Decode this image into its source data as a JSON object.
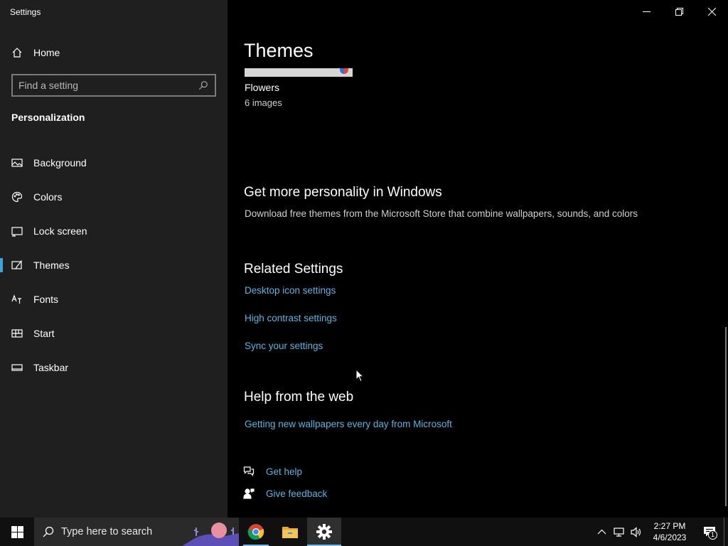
{
  "window": {
    "title": "Settings",
    "controls": [
      "minimize",
      "restore",
      "close"
    ]
  },
  "sidebar": {
    "home_label": "Home",
    "search_placeholder": "Find a setting",
    "section_title": "Personalization",
    "items": [
      {
        "label": "Background",
        "icon": "picture-icon"
      },
      {
        "label": "Colors",
        "icon": "palette-icon"
      },
      {
        "label": "Lock screen",
        "icon": "lock-screen-icon"
      },
      {
        "label": "Themes",
        "icon": "brush-icon",
        "active": true
      },
      {
        "label": "Fonts",
        "icon": "fonts-icon"
      },
      {
        "label": "Start",
        "icon": "start-icon"
      },
      {
        "label": "Taskbar",
        "icon": "taskbar-icon"
      }
    ]
  },
  "main": {
    "page_title": "Themes",
    "theme": {
      "name": "Flowers",
      "count": "6 images"
    },
    "more_personality": {
      "heading": "Get more personality in Windows",
      "description": "Download free themes from the Microsoft Store that combine wallpapers, sounds, and colors"
    },
    "related": {
      "heading": "Related Settings",
      "links": [
        "Desktop icon settings",
        "High contrast settings",
        "Sync your settings"
      ]
    },
    "help_web": {
      "heading": "Help from the web",
      "link": "Getting new wallpapers every day from Microsoft"
    },
    "get_help": "Get help",
    "give_feedback": "Give feedback"
  },
  "taskbar": {
    "search_placeholder": "Type here to search",
    "apps": [
      "chrome-icon",
      "file-explorer-icon",
      "settings-gear-icon"
    ],
    "clock_time": "2:27 PM",
    "clock_date": "4/6/2023",
    "notification_count": "1"
  },
  "colors": {
    "accent_link": "#5cb3e0",
    "sidebar_bg": "#1f1f1f",
    "main_bg": "#000000",
    "active_indicator": "#3aa6d9"
  }
}
